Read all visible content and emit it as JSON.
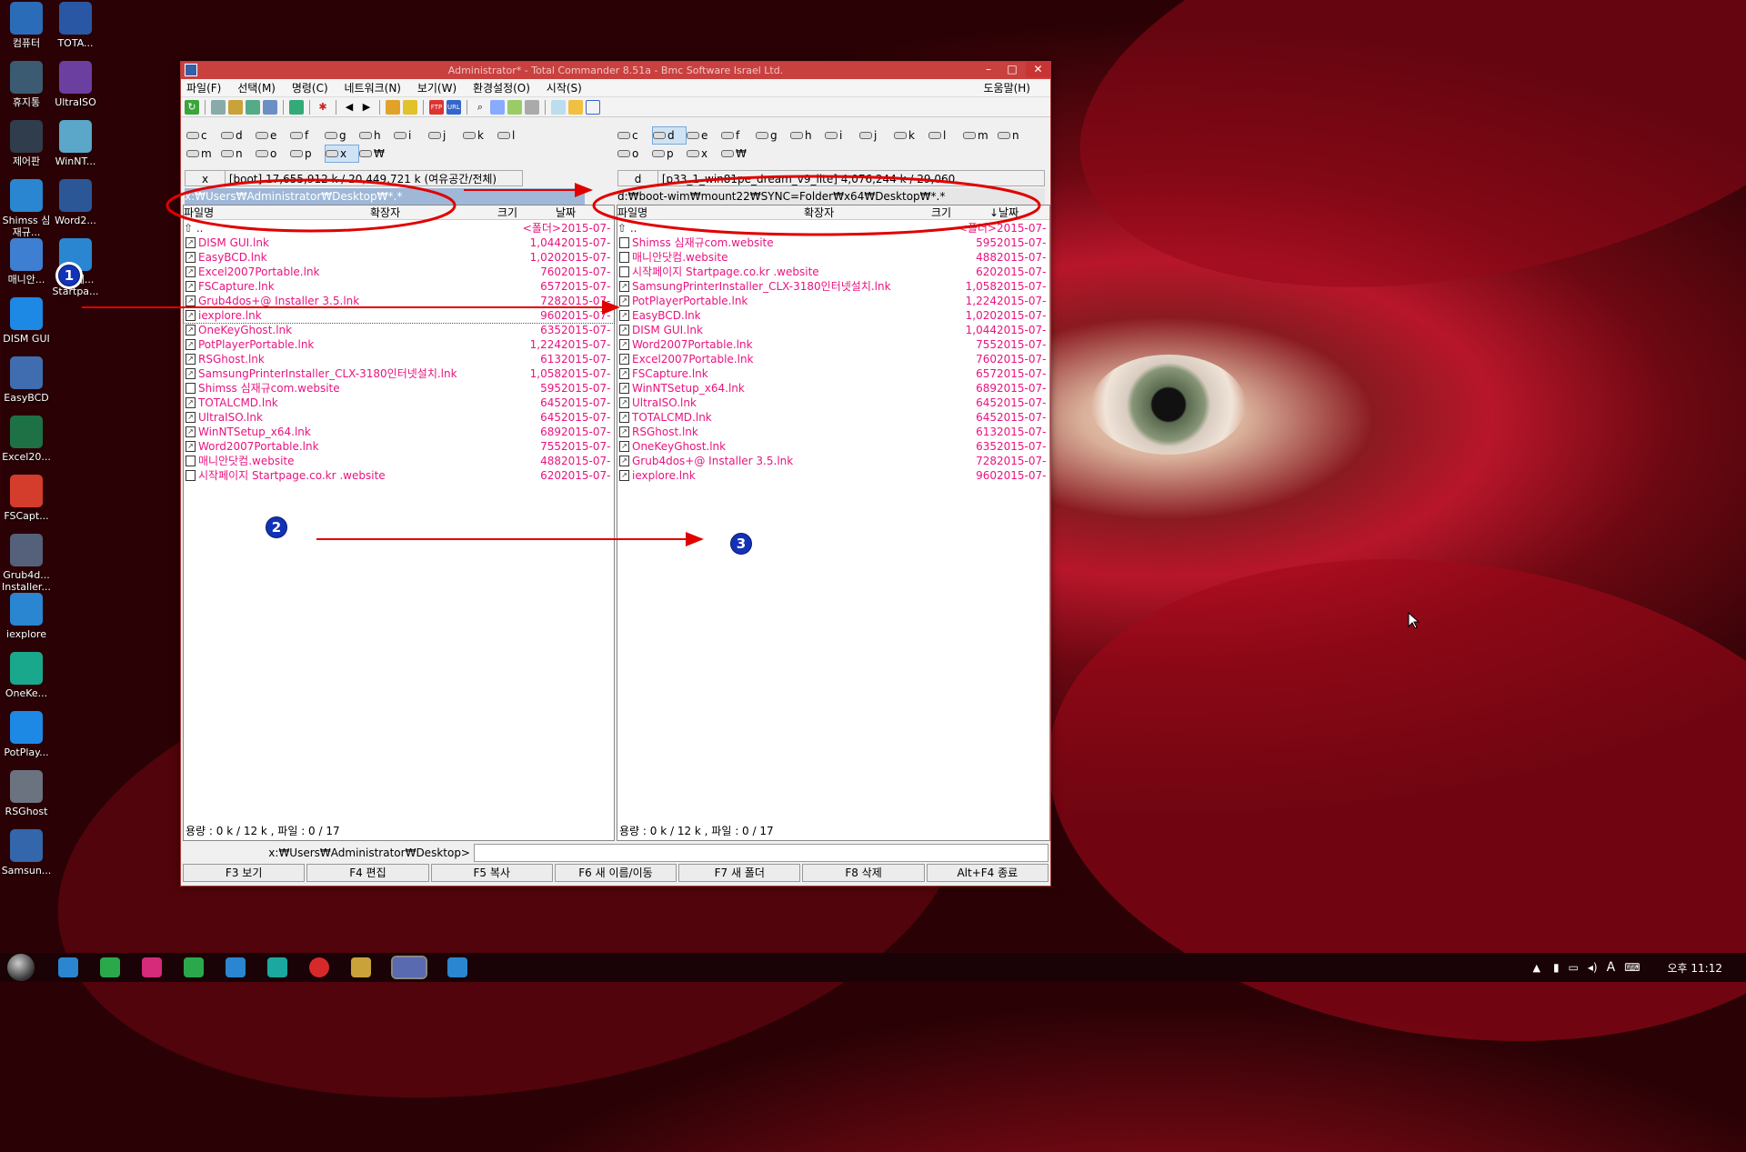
{
  "desktop_icons": [
    {
      "label": "컴퓨터",
      "icon": "computer-icon",
      "color": "#2b6cb8"
    },
    {
      "label": "TOTA...",
      "icon": "floppy-icon",
      "color": "#2a57a4"
    },
    {
      "label": "휴지통",
      "icon": "recycle-bin-icon",
      "color": "#3b5b72"
    },
    {
      "label": "UltraISO",
      "icon": "disc-icon",
      "color": "#6a3fa0"
    },
    {
      "label": "제어판",
      "icon": "control-panel-icon",
      "color": "#2f3d4d"
    },
    {
      "label": "WinNT...",
      "icon": "winnt-icon",
      "color": "#5aa7c9"
    },
    {
      "label": "Shimss 심재규...",
      "icon": "ie-icon",
      "color": "#2a86d0"
    },
    {
      "label": "Word2...",
      "icon": "word-icon",
      "color": "#2b5797"
    },
    {
      "label": "매니안...",
      "icon": "manian-icon",
      "color": "#3f7fd1"
    },
    {
      "label": "시작페... Startpa...",
      "icon": "ie-icon",
      "color": "#2a86d0"
    },
    {
      "label": "DISM GUI",
      "icon": "windows-icon",
      "color": "#1e88e5"
    },
    {
      "label": "EasyBCD",
      "icon": "easybcd-icon",
      "color": "#3f6db0"
    },
    {
      "label": "Excel20...",
      "icon": "excel-icon",
      "color": "#1e7145"
    },
    {
      "label": "FSCapt...",
      "icon": "fscapture-icon",
      "color": "#d43c2c"
    },
    {
      "label": "Grub4d... Installer...",
      "icon": "grub-icon",
      "color": "#55607a"
    },
    {
      "label": "iexplore",
      "icon": "ie-icon",
      "color": "#2a86d0"
    },
    {
      "label": "OneKe...",
      "icon": "onekey-icon",
      "color": "#1aa88c"
    },
    {
      "label": "PotPlay...",
      "icon": "play-icon",
      "color": "#1e88e5"
    },
    {
      "label": "RSGhost",
      "icon": "rsghost-icon",
      "color": "#6b7280"
    },
    {
      "label": "Samsun...",
      "icon": "printer-icon",
      "color": "#3366aa"
    }
  ],
  "window": {
    "title": "Administrator* - Total Commander 8.51a - Bmc Software Israel Ltd.",
    "menu": [
      "파일(F)",
      "선택(M)",
      "명령(C)",
      "네트워크(N)",
      "보기(W)",
      "환경설정(O)",
      "시작(S)"
    ],
    "help": "도움말(H)"
  },
  "left": {
    "drives": [
      "c",
      "d",
      "e",
      "f",
      "g",
      "h",
      "i",
      "j",
      "k",
      "l",
      "m",
      "n",
      "o",
      "p",
      "x",
      "₩"
    ],
    "drive_sel": "x",
    "info": "[boot]  17,655,912 k / 20,449,721 k (여유공간/전체)",
    "path": "x:₩Users₩Administrator₩Desktop₩*.*",
    "cols": [
      "파일명",
      "확장자",
      "크기",
      "날짜"
    ],
    "up": "..",
    "folder": "<폴더>",
    "folder_date": "2015-07-",
    "files": [
      {
        "n": "DISM GUI.lnk",
        "s": "1,044",
        "d": "2015-07-"
      },
      {
        "n": "EasyBCD.lnk",
        "s": "1,020",
        "d": "2015-07-"
      },
      {
        "n": "Excel2007Portable.lnk",
        "s": "760",
        "d": "2015-07-"
      },
      {
        "n": "FSCapture.lnk",
        "s": "657",
        "d": "2015-07-"
      },
      {
        "n": "Grub4dos+@ Installer 3.5.lnk",
        "s": "728",
        "d": "2015-07-"
      },
      {
        "n": "iexplore.lnk",
        "s": "960",
        "d": "2015-07-"
      },
      {
        "n": "OneKeyGhost.lnk",
        "s": "635",
        "d": "2015-07-"
      },
      {
        "n": "PotPlayerPortable.lnk",
        "s": "1,224",
        "d": "2015-07-"
      },
      {
        "n": "RSGhost.lnk",
        "s": "613",
        "d": "2015-07-"
      },
      {
        "n": "SamsungPrinterInstaller_CLX-3180인터넷설치.lnk",
        "s": "1,058",
        "d": "2015-07-"
      },
      {
        "n": "Shimss 심재규com.website",
        "s": "595",
        "d": "2015-07-"
      },
      {
        "n": "TOTALCMD.lnk",
        "s": "645",
        "d": "2015-07-"
      },
      {
        "n": "UltraISO.lnk",
        "s": "645",
        "d": "2015-07-"
      },
      {
        "n": "WinNTSetup_x64.lnk",
        "s": "689",
        "d": "2015-07-"
      },
      {
        "n": "Word2007Portable.lnk",
        "s": "755",
        "d": "2015-07-"
      },
      {
        "n": "매니안닷컴.website",
        "s": "488",
        "d": "2015-07-"
      },
      {
        "n": "시작페이지  Startpage.co.kr .website",
        "s": "620",
        "d": "2015-07-"
      }
    ],
    "status": "용량 : 0 k / 12 k , 파일 : 0 / 17"
  },
  "right": {
    "drives": [
      "c",
      "d",
      "e",
      "f",
      "g",
      "h",
      "i",
      "j",
      "k",
      "l",
      "m",
      "n",
      "o",
      "p",
      "x",
      "₩"
    ],
    "drive_sel": "d",
    "info": "[p33_1_win81pe_dream_v9_lite]  4,076,244 k / 29,060,",
    "path": "d:₩boot-wim₩mount22₩SYNC=Folder₩x64₩Desktop₩*.*",
    "cols": [
      "파일명",
      "확장자",
      "크기",
      "↓날짜"
    ],
    "up": "..",
    "folder": "<폴더>",
    "folder_date": "2015-07-",
    "files": [
      {
        "n": "Shimss 심재규com.website",
        "s": "595",
        "d": "2015-07-"
      },
      {
        "n": "매니안닷컴.website",
        "s": "488",
        "d": "2015-07-"
      },
      {
        "n": "시작페이지  Startpage.co.kr .website",
        "s": "620",
        "d": "2015-07-"
      },
      {
        "n": "SamsungPrinterInstaller_CLX-3180인터넷설치.lnk",
        "s": "1,058",
        "d": "2015-07-"
      },
      {
        "n": "PotPlayerPortable.lnk",
        "s": "1,224",
        "d": "2015-07-"
      },
      {
        "n": "EasyBCD.lnk",
        "s": "1,020",
        "d": "2015-07-"
      },
      {
        "n": "DISM GUI.lnk",
        "s": "1,044",
        "d": "2015-07-"
      },
      {
        "n": "Word2007Portable.lnk",
        "s": "755",
        "d": "2015-07-"
      },
      {
        "n": "Excel2007Portable.lnk",
        "s": "760",
        "d": "2015-07-"
      },
      {
        "n": "FSCapture.lnk",
        "s": "657",
        "d": "2015-07-"
      },
      {
        "n": "WinNTSetup_x64.lnk",
        "s": "689",
        "d": "2015-07-"
      },
      {
        "n": "UltraISO.lnk",
        "s": "645",
        "d": "2015-07-"
      },
      {
        "n": "TOTALCMD.lnk",
        "s": "645",
        "d": "2015-07-"
      },
      {
        "n": "RSGhost.lnk",
        "s": "613",
        "d": "2015-07-"
      },
      {
        "n": "OneKeyGhost.lnk",
        "s": "635",
        "d": "2015-07-"
      },
      {
        "n": "Grub4dos+@ Installer 3.5.lnk",
        "s": "728",
        "d": "2015-07-"
      },
      {
        "n": "iexplore.lnk",
        "s": "960",
        "d": "2015-07-"
      }
    ],
    "status": "용량 : 0 k / 12 k , 파일 : 0 / 17"
  },
  "cmdline": "x:₩Users₩Administrator₩Desktop>",
  "fkeys": [
    "F3 보기",
    "F4 편집",
    "F5 복사",
    "F6 새 이름/이동",
    "F7 새 폴더",
    "F8 삭제",
    "Alt+F4 종료"
  ],
  "annotations": [
    "1",
    "2",
    "3"
  ],
  "taskbar": {
    "clock": "오후 11:12",
    "tray": "A"
  },
  "colors": {
    "file_text": "#e8147f",
    "title": "#c8413f",
    "annot_red": "#e00000",
    "annot_blue": "#1232b8"
  }
}
